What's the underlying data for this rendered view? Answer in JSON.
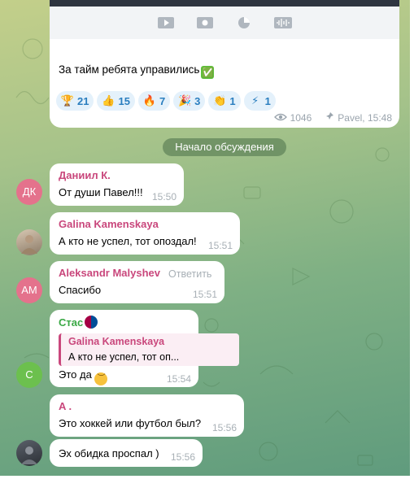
{
  "colors": {
    "author_daniil": "#c9477c",
    "author_galina": "#c9477c",
    "author_aleksandr": "#c9477c",
    "author_stas": "#3aa845",
    "author_a": "#c9477c",
    "reaction_text": "#2a7ebf",
    "avatar_dk": "#e4728c",
    "avatar_am": "#e4728c",
    "avatar_c": "#6cc04e"
  },
  "post": {
    "text": "За тайм ребята управились",
    "text_emoji": "✅",
    "media_icons": [
      "play-icon",
      "photo-icon",
      "pie-icon",
      "audio-wave-icon"
    ],
    "reactions": [
      {
        "emoji": "🏆",
        "icon": "trophy-icon",
        "count": "21"
      },
      {
        "emoji": "👍",
        "icon": "thumbs-up-icon",
        "count": "15"
      },
      {
        "emoji": "🔥",
        "icon": "fire-icon",
        "count": "7"
      },
      {
        "emoji": "🎉",
        "icon": "party-icon",
        "count": "3"
      },
      {
        "emoji": "👏",
        "icon": "clap-icon",
        "count": "1"
      },
      {
        "emoji": "⚡",
        "icon": "lightning-icon",
        "count": "1"
      }
    ],
    "views": "1046",
    "signature": "Pavel, 15:48"
  },
  "discussion_label": "Начало обсуждения",
  "messages": [
    {
      "author": "Даниил К.",
      "text": "От души Павел!!!",
      "time": "15:50",
      "avatar_initials": "ДК"
    },
    {
      "author": "Galina Kamenskaya",
      "text": "А кто не успел, тот опоздал!",
      "time": "15:51"
    },
    {
      "author": "Aleksandr Malyshev",
      "reply_label": "Ответить",
      "text": "Спасибо",
      "time": "15:51",
      "avatar_initials": "AM"
    },
    {
      "author": "Стас",
      "quote_author": "Galina Kamenskaya",
      "quote_text": "А кто не успел, тот оп...",
      "text": "Это да",
      "time": "15:54",
      "avatar_initials": "С"
    },
    {
      "author": "A .",
      "text": "Это хоккей или футбол был?",
      "time": "15:56"
    },
    {
      "text": "Эх обидка проспал )",
      "time": "15:56"
    }
  ]
}
